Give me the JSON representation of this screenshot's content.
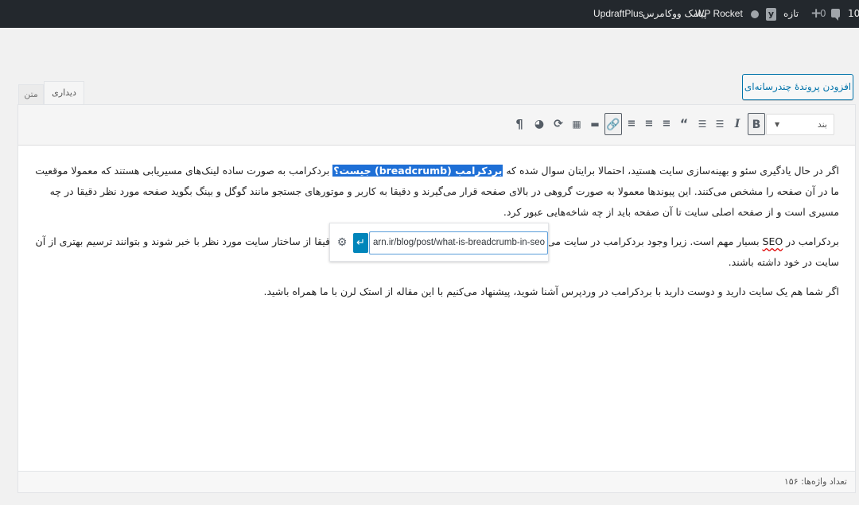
{
  "admin_bar": {
    "comments_count": "10",
    "comments_label": "",
    "updates_count": "0",
    "new_label": "تازه",
    "wp_rocket_label": "WP Rocket",
    "sms_label": "پیامک ووکامرس",
    "updraft_label": "UpdraftPlus"
  },
  "media_button": {
    "label": "افزودن پروندهٔ چندرسانه‌ای"
  },
  "tabs": {
    "visual": "دیداری",
    "text": "متن"
  },
  "toolbar": {
    "format_value": "بند",
    "buttons": [
      "B",
      "I",
      "bulleted-list",
      "numbered-list",
      "blockquote",
      "align-left",
      "align-center",
      "align-right",
      "link",
      "read-more",
      "toolbar-toggle",
      "add-media",
      "permalink",
      "paragraph"
    ]
  },
  "content": {
    "p1_before": "اگر در حال یادگیری سئو و بهینه‌سازی سایت هستید، احتمالا برایتان سوال شده که ",
    "p1_highlight": "بردکرامب (breadcrumb) جیست؟",
    "p1_after": " بردکرامب به صورت ساده لینک‌های مسیریابی هستند که معمولا موقعیت ما در آن صفحه را مشخص می‌کنند. این پیوندها معمولا به صورت گروهی در بالای صفحه قرار می‌گیرند و دقیقا به کاربر و موتورهای جستجو مانند گوگل و بینگ بگوید صفحه مورد نظر دقیقا در چه مسیری است و از صفحه اصلی سایت تا آن صفحه باید از چه شاخه‌هایی عبور کرد.",
    "p2_before": "بردکرامب در ",
    "p2_seo": "SEO",
    "p2_after": " بسیار مهم است. زیرا وجود بردکرامب در سایت می‌تواند یک نقشه سایت به گوگل و بینگ بدهد تا بتوانند دقیقا از ساختار سایت مورد نظر با خبر شوند و بتوانند ترسیم بهتری از آن سایت در خود داشته باشند.",
    "p3": "اگر شما هم یک سایت دارید و دوست دارید با بردکرامب در وردپرس آشنا شوید، پیشنهاد می‌کنیم با این مقاله از استک لرن با ما همراه باشید."
  },
  "link_popup": {
    "url": "arn.ir/blog/post/what-is-breadcrumb-in-seo"
  },
  "status": {
    "word_count": "تعداد واژه‌ها: ۱۵۶"
  },
  "colors": {
    "accent": "#0073aa",
    "highlight": "#1e6fd6",
    "admin_bar": "#23282d"
  }
}
